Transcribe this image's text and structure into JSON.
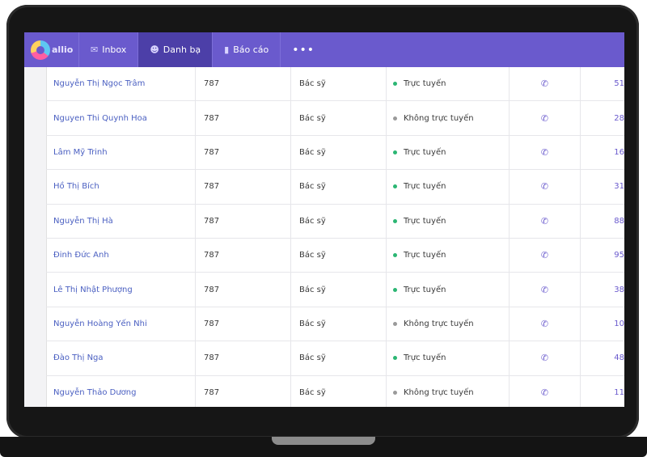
{
  "app": {
    "logo_text": "allio"
  },
  "nav": [
    {
      "label": "Inbox",
      "icon": "inbox-icon",
      "active": false
    },
    {
      "label": "Danh bạ",
      "icon": "contacts-icon",
      "active": true
    },
    {
      "label": "Báo cáo",
      "icon": "report-chart-icon",
      "active": false
    }
  ],
  "nav_more": "•••",
  "colors": {
    "accent": "#6a5acd",
    "online": "#2bb673",
    "offline": "#9a9a9a"
  },
  "contacts": [
    {
      "name": "Nguyễn Thị Ngọc Trâm",
      "ext": "787",
      "role": "Bác sỹ",
      "status": "Trực tuyến",
      "online": true,
      "num": "51"
    },
    {
      "name": "Nguyen Thi Quynh Hoa",
      "ext": "787",
      "role": "Bác sỹ",
      "status": "Không trực tuyến",
      "online": false,
      "num": "28"
    },
    {
      "name": "Lâm Mỹ Trinh",
      "ext": "787",
      "role": "Bác sỹ",
      "status": "Trực tuyến",
      "online": true,
      "num": "16"
    },
    {
      "name": "Hồ Thị Bích",
      "ext": "787",
      "role": "Bác sỹ",
      "status": "Trực tuyến",
      "online": true,
      "num": "31"
    },
    {
      "name": "Nguyễn Thị Hà",
      "ext": "787",
      "role": "Bác sỹ",
      "status": "Trực tuyến",
      "online": true,
      "num": "88"
    },
    {
      "name": "Đinh Đức Anh",
      "ext": "787",
      "role": "Bác sỹ",
      "status": "Trực tuyến",
      "online": true,
      "num": "95"
    },
    {
      "name": "Lê Thị Nhật Phượng",
      "ext": "787",
      "role": "Bác sỹ",
      "status": "Trực tuyến",
      "online": true,
      "num": "38"
    },
    {
      "name": "Nguyễn Hoàng Yến Nhi",
      "ext": "787",
      "role": "Bác sỹ",
      "status": "Không trực tuyến",
      "online": false,
      "num": "10"
    },
    {
      "name": "Đào Thị Nga",
      "ext": "787",
      "role": "Bác sỹ",
      "status": "Trực tuyến",
      "online": true,
      "num": "48"
    },
    {
      "name": "Nguyễn Thảo Dương",
      "ext": "787",
      "role": "Bác sỹ",
      "status": "Không trực tuyến",
      "online": false,
      "num": "11"
    }
  ]
}
